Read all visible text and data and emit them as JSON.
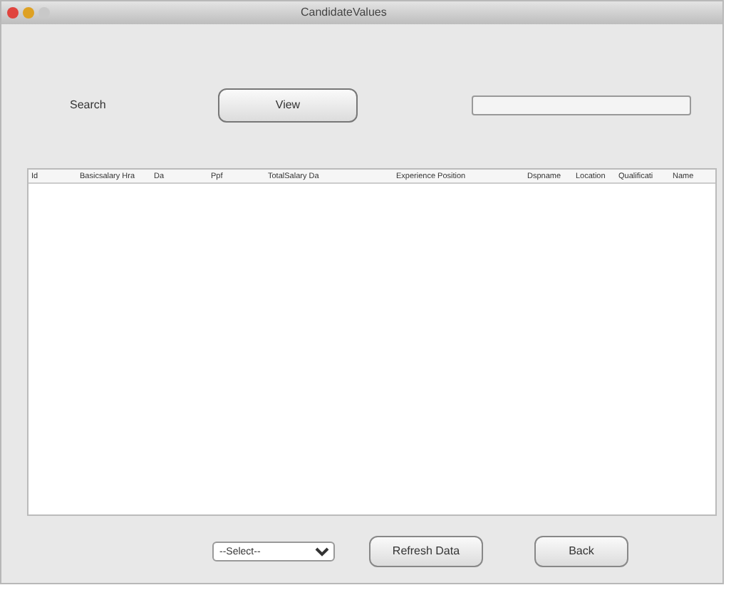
{
  "window": {
    "title": "CandidateValues"
  },
  "search": {
    "label": "Search",
    "button": "View"
  },
  "table": {
    "columns": [
      "Id",
      "Basicsalary Hra",
      "Da",
      "Ppf",
      "TotalSalary Da",
      "Experience Position",
      "Dspname",
      "Location",
      "Qualificati",
      "Name"
    ]
  },
  "footer": {
    "select": "--Select--",
    "buttons": [
      "Refresh Data",
      "Back"
    ]
  }
}
